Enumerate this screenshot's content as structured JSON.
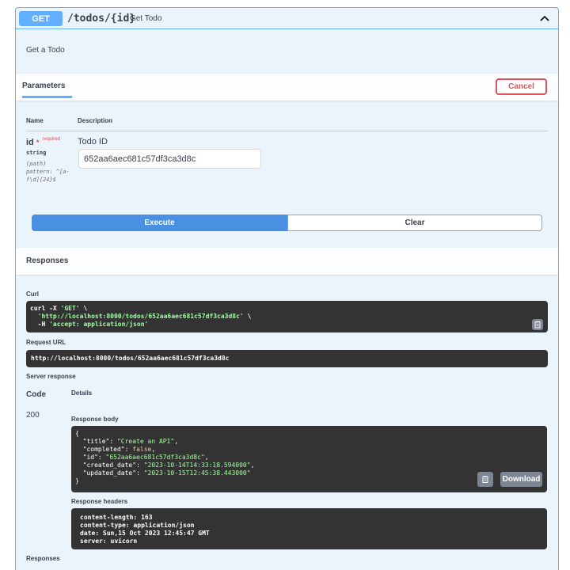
{
  "summary": {
    "method": "GET",
    "path": "/todos/{id}",
    "description": "Get Todo"
  },
  "description": "Get a Todo",
  "parameters": {
    "title": "Parameters",
    "cancel_label": "Cancel",
    "col_name": "Name",
    "col_description": "Description",
    "param": {
      "name": "id",
      "star": "*",
      "required": "required",
      "type": "string",
      "in": "(path)",
      "pattern": "pattern: ^[a-f\\d]{24}$",
      "label": "Todo ID",
      "value": "652aa6aec681c57df3ca3d8c"
    }
  },
  "actions": {
    "execute_label": "Execute",
    "clear_label": "Clear"
  },
  "responses": {
    "title": "Responses",
    "curl_label": "Curl",
    "curl_line1_a": "curl -X ",
    "curl_line1_b": "'GET'",
    "curl_line1_c": " \\",
    "curl_line2_a": "  ",
    "curl_line2_b": "'http://localhost:8000/todos/652aa6aec681c57df3ca3d8c'",
    "curl_line2_c": " \\",
    "curl_line3_a": "  -H ",
    "curl_line3_b": "'accept: application/json'",
    "request_url_label": "Request URL",
    "request_url": "http://localhost:8000/todos/652aa6aec681c57df3ca3d8c",
    "server_response_label": "Server response",
    "code_header": "Code",
    "details_header": "Details",
    "status_code": "200",
    "response_body_label": "Response body",
    "body": {
      "open": "{",
      "title_key": "  \"title\": ",
      "title_val": "\"Create an API\"",
      "completed_key": "  \"completed\": ",
      "completed_val": "false",
      "id_key": "  \"id\": ",
      "id_val": "\"652aa6aec681c57df3ca3d8c\"",
      "created_key": "  \"created_date\": ",
      "created_val": "\"2023-10-14T14:33:18.594000\"",
      "updated_key": "  \"updated_date\": ",
      "updated_val": "\"2023-10-15T12:45:38.443000\"",
      "close": "}"
    },
    "download_label": "Download",
    "response_headers_label": "Response headers",
    "headers": [
      "content-length: 163",
      "content-type: application/json",
      "date: Sun,15 Oct 2023 12:45:47 GMT",
      "server: uvicorn"
    ],
    "bottom_title": "Responses"
  },
  "colors": {
    "accent": "#61affe",
    "execute": "#4990e2",
    "cancel": "#e0505a",
    "code_bg": "#333333",
    "string": "#a2fca2",
    "bool": "#fcc28c"
  },
  "icons": {
    "collapse": "chevron-up-icon",
    "copy": "clipboard-icon"
  }
}
